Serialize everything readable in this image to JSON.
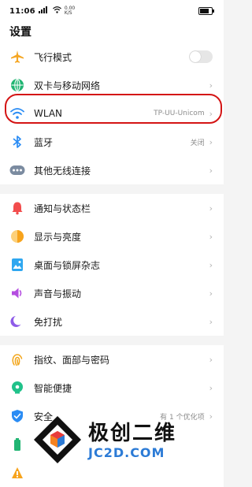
{
  "status_bar": {
    "time": "11:06",
    "mini_text_top": "0.00",
    "mini_text_bottom": "K/S",
    "battery_level": 0.8
  },
  "header": {
    "title": "设置"
  },
  "groups": [
    {
      "items": [
        {
          "label": "飞行模式",
          "icon": "airplane-icon",
          "toggle": false
        },
        {
          "label": "双卡与移动网络",
          "icon": "globe-icon"
        },
        {
          "label": "WLAN",
          "icon": "wifi-icon",
          "value": "TP-UU-Unicom",
          "highlighted": true
        },
        {
          "label": "蓝牙",
          "icon": "bluetooth-icon",
          "value": "关闭"
        },
        {
          "label": "其他无线连接",
          "icon": "more-connections-icon"
        }
      ]
    },
    {
      "items": [
        {
          "label": "通知与状态栏",
          "icon": "bell-icon"
        },
        {
          "label": "显示与亮度",
          "icon": "brightness-icon"
        },
        {
          "label": "桌面与锁屏杂志",
          "icon": "wallpaper-icon"
        },
        {
          "label": "声音与振动",
          "icon": "sound-icon"
        },
        {
          "label": "免打扰",
          "icon": "moon-icon"
        }
      ]
    },
    {
      "items": [
        {
          "label": "指纹、面部与密码",
          "icon": "fingerprint-icon"
        },
        {
          "label": "智能便捷",
          "icon": "smart-assist-icon"
        },
        {
          "label": "安全",
          "icon": "shield-icon",
          "value": "有 1 个优化项"
        }
      ]
    }
  ],
  "watermark": {
    "title": "极创二维",
    "subtitle": "JC2D.COM"
  },
  "colors": {
    "airplane": "#f5a623",
    "globe": "#21b573",
    "wifi": "#2a8cf4",
    "bluetooth": "#2a8cf4",
    "more": "#7b8ba0",
    "bell": "#f24d4d",
    "brightness": "#f7a31c",
    "wallpaper": "#2ea7f0",
    "sound": "#b44de0",
    "moon": "#8e5be8",
    "fingerprint": "#f2a51a",
    "smart": "#20c28a",
    "shield": "#2a8cf4",
    "highlight": "#d41414"
  }
}
